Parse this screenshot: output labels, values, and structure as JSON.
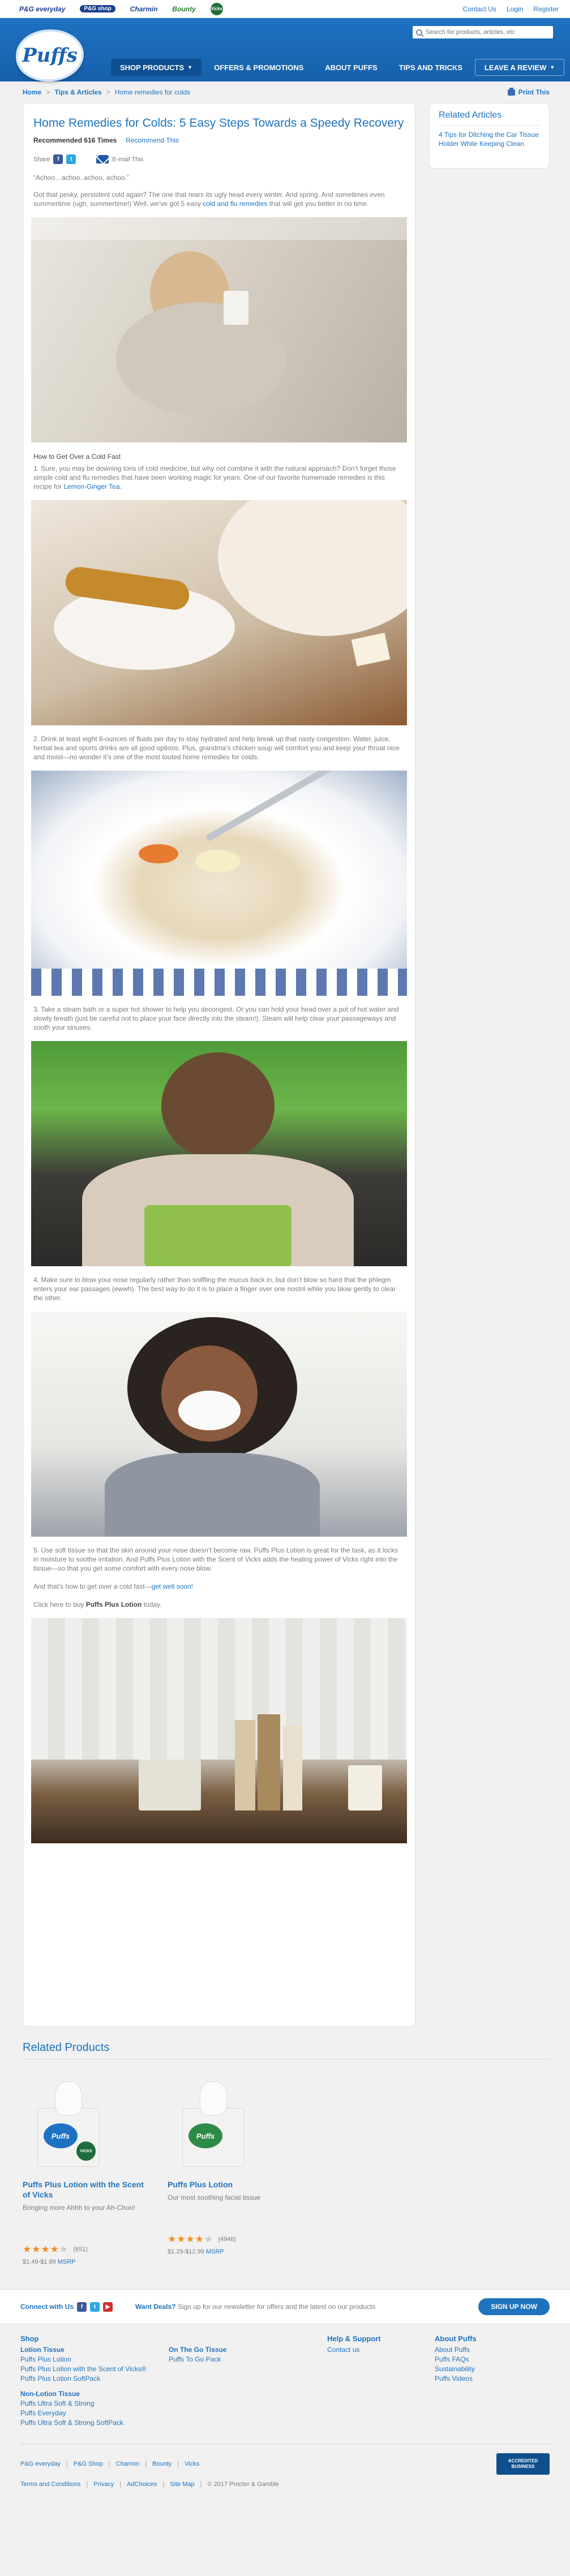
{
  "topbar": {
    "brands": [
      "P&G everyday",
      "P&G shop",
      "Charmin",
      "Bounty",
      "Vicks"
    ],
    "links": [
      "Contact Us",
      "Login",
      "Register"
    ]
  },
  "header": {
    "logo": "Puffs",
    "search_placeholder": "Search for products, articles, etc",
    "nav": [
      {
        "label": "Shop Products",
        "caret": "▼"
      },
      {
        "label": "Offers & Promotions"
      },
      {
        "label": "About Puffs"
      },
      {
        "label": "Tips and Tricks"
      },
      {
        "label": "Leave a Review",
        "caret": "▼"
      }
    ]
  },
  "breadcrumb": {
    "home": "Home",
    "section": "Tips & Articles",
    "current": "Home remedies for colds",
    "print_label": "Print This"
  },
  "article": {
    "title": "Home Remedies for Colds: 5 Easy Steps Towards a Speedy Recovery",
    "recommended": "Recommended 616 Times",
    "recommend_link": "Recommend This",
    "share_label": "Share",
    "email_label": "E-mail This",
    "quote": "“Achoo…achoo..achoo, achoo.”",
    "intro": "Got that pesky, persistent cold again? The one that rears its ugly head every winter. And spring. And sometimes even summertime (ugh, summertime!) Well, we’ve got 5 easy ",
    "intro_link": "cold and flu remedies",
    "intro_end": " that will get you better in no time.",
    "subhead": "How to Get Over a Cold Fast",
    "step1": "1. Sure, you may be downing tons of cold medicine, but why not combine it with the natural approach? Don’t forget those simple cold and flu remedies that have been working magic for years. One of our favorite homemade remedies is this recipe for ",
    "step1_link": "Lemon-Ginger Tea",
    "step1_end": ".",
    "step2": "2. Drink at least eight 8-ounces of fluids per day to stay hydrated and help break up that nasty congestion. Water, juice, herbal tea and sports drinks are all good options. Plus, grandma’s chicken soup will comfort you and keep your throat nice and moist—no wonder it’s one of the most touted home remedies for colds.",
    "step3": "3. Take a steam bath or a super hot shower to help you decongest. Or you can hold your head over a pot of hot water and slowly breath (just be careful not to place your face directly into the steam!). Steam will help clear your passageways and sooth your sinuses.",
    "step4": "4. Make sure to blow your nose regularly rather than sniffling the mucus back in, but don’t blow so hard that the phlegm enters your ear passages (ewwh). The best way to do it is to place a finger over one nostril while you blow gently to clear the other.",
    "step5": "5. Use soft tissue so that the skin around your nose doesn’t become raw. Puffs Plus Lotion is great for the task, as it locks in moisture to soothe irritation. And Puffs Plus Lotion with the Scent of Vicks adds the healing power of Vicks right into the tissue—so that you get some comfort with every nose blow.",
    "outro": "And that’s how to get over a cold fast—",
    "outro_link": "get well soon!",
    "buy": "Click here to buy ",
    "buy_bold": "Puffs Plus Lotion",
    "buy_end": " today."
  },
  "sidebar": {
    "heading": "Related Articles",
    "link": "4 Tips for Ditching the Car Tissue Holder While Keeping Clean"
  },
  "related_products": {
    "heading": "Related Products",
    "items": [
      {
        "box_label": "Puffs",
        "badge": "VICKS",
        "name": "Puffs Plus Lotion with the Scent of Vicks",
        "desc": "Bringing more Ahhh to your Ah-Choo!",
        "stars": 4.5,
        "count": "(651)",
        "price": "$1.49-$1.99",
        "msrp": "MSRP"
      },
      {
        "box_label": "Puffs",
        "badge": "",
        "name": "Puffs Plus Lotion",
        "desc": "Our most soothing facial tissue",
        "stars": 4.5,
        "count": "(4946)",
        "price": "$1.29-$12.99",
        "msrp": "MSRP"
      }
    ]
  },
  "newsletter": {
    "connect": "Connect with Us",
    "want": "Want Deals?",
    "text": " Sign up for our newsletter for offers and the latest on our products",
    "button": "Sign Up Now"
  },
  "footer": {
    "shop_heading": "Shop",
    "lotion_heading": "Lotion Tissue",
    "lotion": [
      "Puffs Plus Lotion",
      "Puffs Plus Lotion with the Scent of Vicks®",
      "Puffs Plus Lotion SoftPack"
    ],
    "nonlotion_heading": "Non-Lotion Tissue",
    "nonlotion": [
      "Puffs Ultra Soft & Strong",
      "Puffs Everyday",
      "Puffs Ultra Soft & Strong SoftPack"
    ],
    "go_heading": "On The Go Tissue",
    "go": [
      "Puffs To Go Pack"
    ],
    "help_heading": "Help & Support",
    "help": [
      "Contact us"
    ],
    "about_heading": "About Puffs",
    "about": [
      "About Puffs",
      "Puffs FAQs",
      "Sustainability",
      "Puffs Videos"
    ],
    "brands": [
      "P&G everyday",
      "P&G Shop",
      "Charmin",
      "Bounty",
      "Vicks"
    ],
    "bbb": "ACCREDITED BUSINESS",
    "legal": [
      "Terms and Conditions",
      "Privacy",
      "AdChoices",
      "Site Map",
      "© 2017 Procter & Gamble"
    ]
  },
  "colors": {
    "brand_blue": "#1e73be",
    "nav_blue": "#1760aa",
    "star": "#f28c1c"
  }
}
